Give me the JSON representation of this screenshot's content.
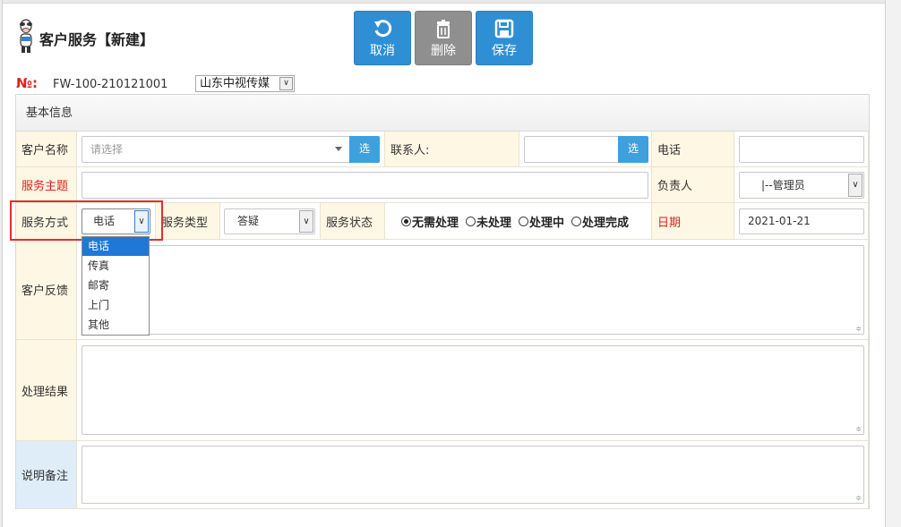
{
  "page": {
    "title": "客户服务【新建】"
  },
  "toolbar": {
    "cancel_label": "取消",
    "delete_label": "删除",
    "save_label": "保存"
  },
  "record": {
    "no_label": "№:",
    "no_value": "FW-100-210121001",
    "company": "山东中视传媒"
  },
  "panel": {
    "title": "基本信息"
  },
  "form": {
    "customer_name_label": "客户名称",
    "customer_name_placeholder": "请选择",
    "choose_label": "选",
    "contact_label": "联系人:",
    "phone_label": "电话",
    "subject_label": "服务主题",
    "owner_label": "负责人",
    "owner_value": "|--管理员",
    "service_method_label": "服务方式",
    "service_method_value": "电话",
    "service_type_label": "服务类型",
    "service_type_value": "答疑",
    "service_status_label": "服务状态",
    "status_options": [
      {
        "label": "无需处理",
        "checked": true
      },
      {
        "label": "未处理",
        "checked": false
      },
      {
        "label": "处理中",
        "checked": false
      },
      {
        "label": "处理完成",
        "checked": false
      }
    ],
    "date_label": "日期",
    "date_value": "2021-01-21",
    "feedback_label": "客户反馈",
    "result_label": "处理结果",
    "remarks_label": "说明备注"
  },
  "service_method_options": [
    "电话",
    "传真",
    "邮寄",
    "上门",
    "其他"
  ],
  "colors": {
    "accent_blue": "#2f8fd4",
    "delete_gray": "#8f8f8f",
    "required_red": "#e02020",
    "label_bg": "#fdf7e3",
    "highlight": "#e03030",
    "dropdown_selected": "#1e78d6"
  }
}
